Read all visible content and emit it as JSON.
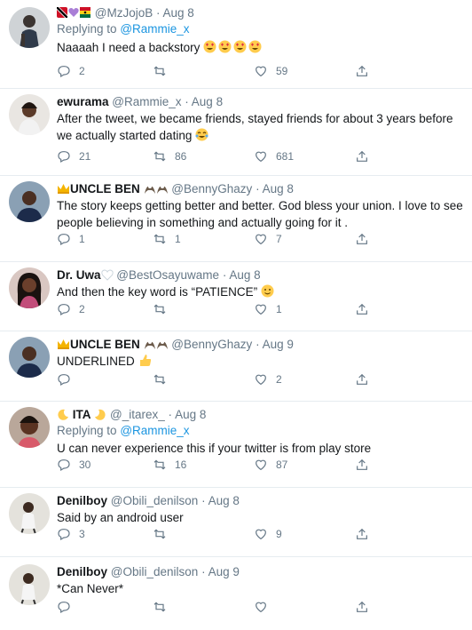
{
  "tweets": [
    {
      "name": "",
      "name_prefix_icons": [
        "trinidad-flag",
        "purple-heart",
        "ghana-flag"
      ],
      "handle": "@MzJojoB",
      "date": "Aug 8",
      "replying_label": "Replying to",
      "replying_to": "@Rammie_x",
      "text": "Naaaah I need a backstory",
      "text_emoji": "heart-eyes-emoji x4",
      "replies": "2",
      "retweets": "",
      "likes": "59"
    },
    {
      "name": "ewurama",
      "handle": "@Rammie_x",
      "date": "Aug 8",
      "text": "After the tweet, we became friends, stayed friends for about 3 years before we actually started dating",
      "text_emoji": "tears-of-joy-emoji",
      "replies": "21",
      "retweets": "86",
      "likes": "681"
    },
    {
      "name": "UNCLE BEN",
      "name_icons": [
        "crown-icon",
        "eagle-icon",
        "eagle-icon"
      ],
      "handle": "@BennyGhazy",
      "date": "Aug 8",
      "text": "The story keeps getting better and better. God bless your union. I love to see people believing in something and actually going for it .",
      "replies": "1",
      "retweets": "1",
      "likes": "7"
    },
    {
      "name": "Dr. Uwa",
      "name_icons": [
        "white-heart-icon"
      ],
      "handle": "@BestOsayuwame",
      "date": "Aug 8",
      "text": "And then the key word is “PATIENCE”",
      "text_emoji": "slightly-smiling-emoji",
      "replies": "2",
      "retweets": "",
      "likes": "1"
    },
    {
      "name": "UNCLE BEN",
      "name_icons": [
        "crown-icon",
        "eagle-icon",
        "eagle-icon"
      ],
      "handle": "@BennyGhazy",
      "date": "Aug 9",
      "text": "UNDERLINED",
      "text_emoji": "thumbs-up-emoji",
      "replies": "",
      "retweets": "",
      "likes": "2"
    },
    {
      "name": "ITA",
      "name_icons": [
        "moon-icon",
        "moon-icon"
      ],
      "handle": "@_itarex_",
      "date": "Aug 8",
      "replying_label": "Replying to",
      "replying_to": "@Rammie_x",
      "text": "U can never experience this if your twitter is from play store",
      "replies": "30",
      "retweets": "16",
      "likes": "87"
    },
    {
      "name": "Denilboy",
      "handle": "@Obili_denilson",
      "date": "Aug 8",
      "text": "Said by an android user",
      "replies": "3",
      "retweets": "",
      "likes": "9"
    },
    {
      "name": "Denilboy",
      "handle": "@Obili_denilson",
      "date": "Aug 9",
      "text": "*Can Never*",
      "replies": "",
      "retweets": "",
      "likes": ""
    }
  ],
  "separator": "·",
  "colors": {
    "text": "#14171a",
    "muted": "#657786",
    "link": "#1b95e0",
    "border": "#e6ecf0"
  }
}
